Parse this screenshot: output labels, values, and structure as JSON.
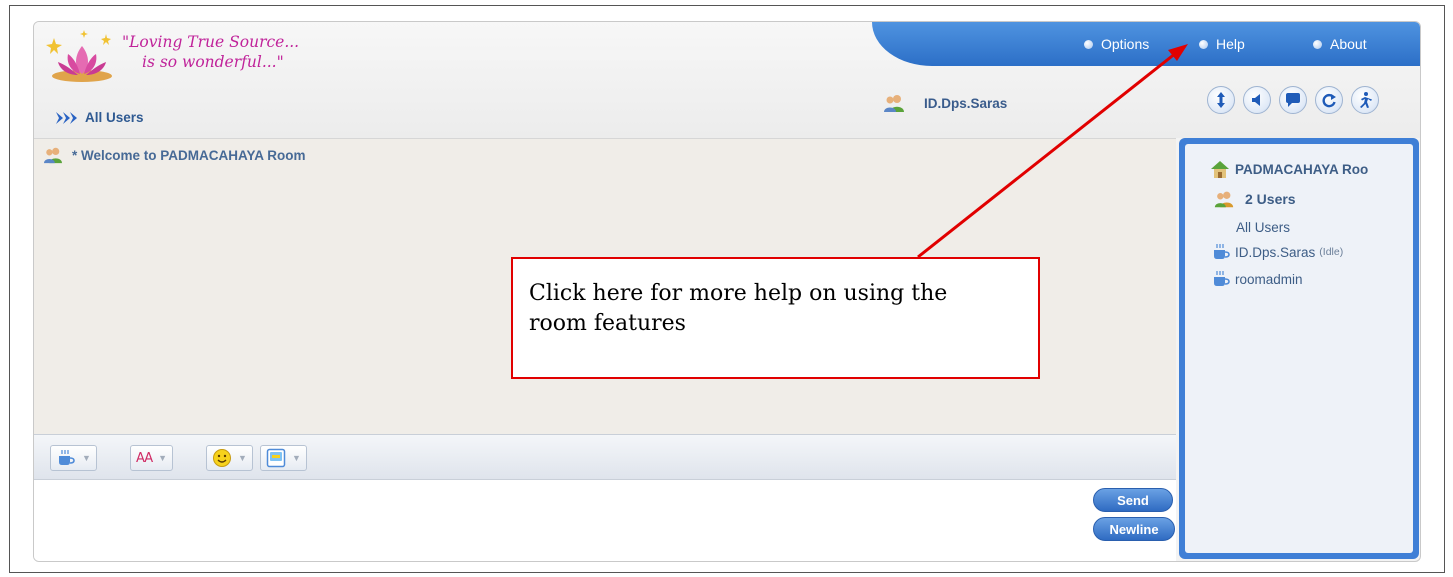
{
  "header": {
    "slogan_line1": "\"Loving True Source...",
    "slogan_line2": "is so wonderful...\""
  },
  "topnav": {
    "options": "Options",
    "help": "Help",
    "about": "About"
  },
  "current_user": "ID.Dps.Saras",
  "tab": {
    "all_users": "All Users"
  },
  "chat": {
    "welcome": "* Welcome to PADMACAHAYA Room"
  },
  "toolbar": {
    "font_label": "AA"
  },
  "input": {
    "send": "Send",
    "newline": "Newline"
  },
  "room": {
    "name": "PADMACAHAYA Roo",
    "user_count": "2 Users",
    "all_users_link": "All Users",
    "users": [
      {
        "name": "ID.Dps.Saras",
        "status": "(Idle)"
      },
      {
        "name": "roomadmin",
        "status": ""
      }
    ]
  },
  "annotation": {
    "text": "Click here for more help on using the room features"
  },
  "icons": {
    "actions": [
      "scroll-icon",
      "speaker-icon",
      "chat-bubble-icon",
      "refresh-icon",
      "exit-icon"
    ]
  },
  "colors": {
    "accent_blue": "#3f7fd6",
    "slogan_pink": "#c0239a",
    "annotation_red": "#e10000"
  }
}
